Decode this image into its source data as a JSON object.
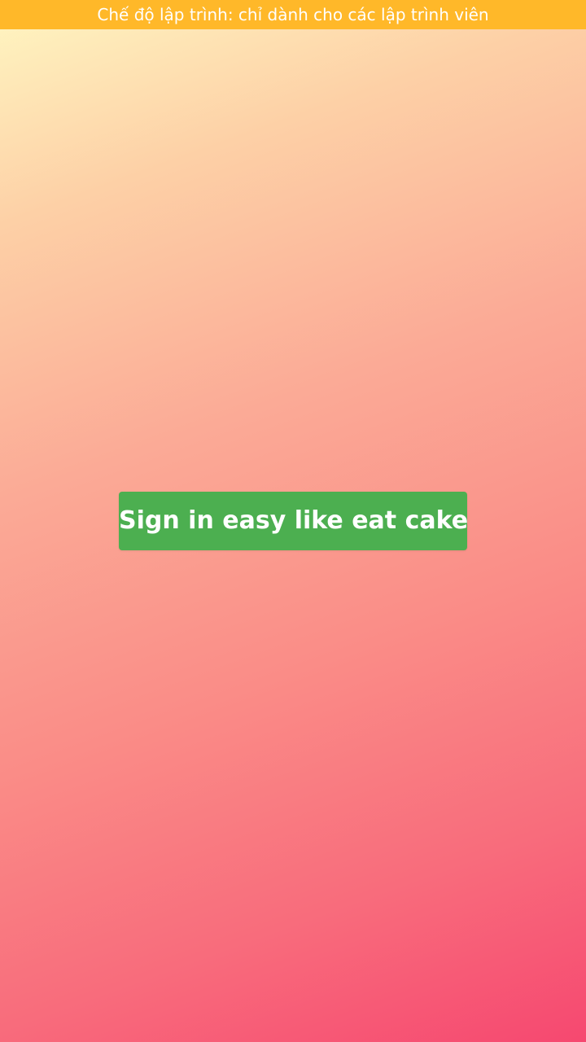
{
  "banner": {
    "text": "Chế độ lập trình: chỉ dành cho các lập trình viên",
    "color": "#ffb829"
  },
  "signin": {
    "label": "Sign in easy like eat cake",
    "color": "#4caf50"
  },
  "background": {
    "gradient_start": "#fff7c2",
    "gradient_end": "#f64870"
  }
}
